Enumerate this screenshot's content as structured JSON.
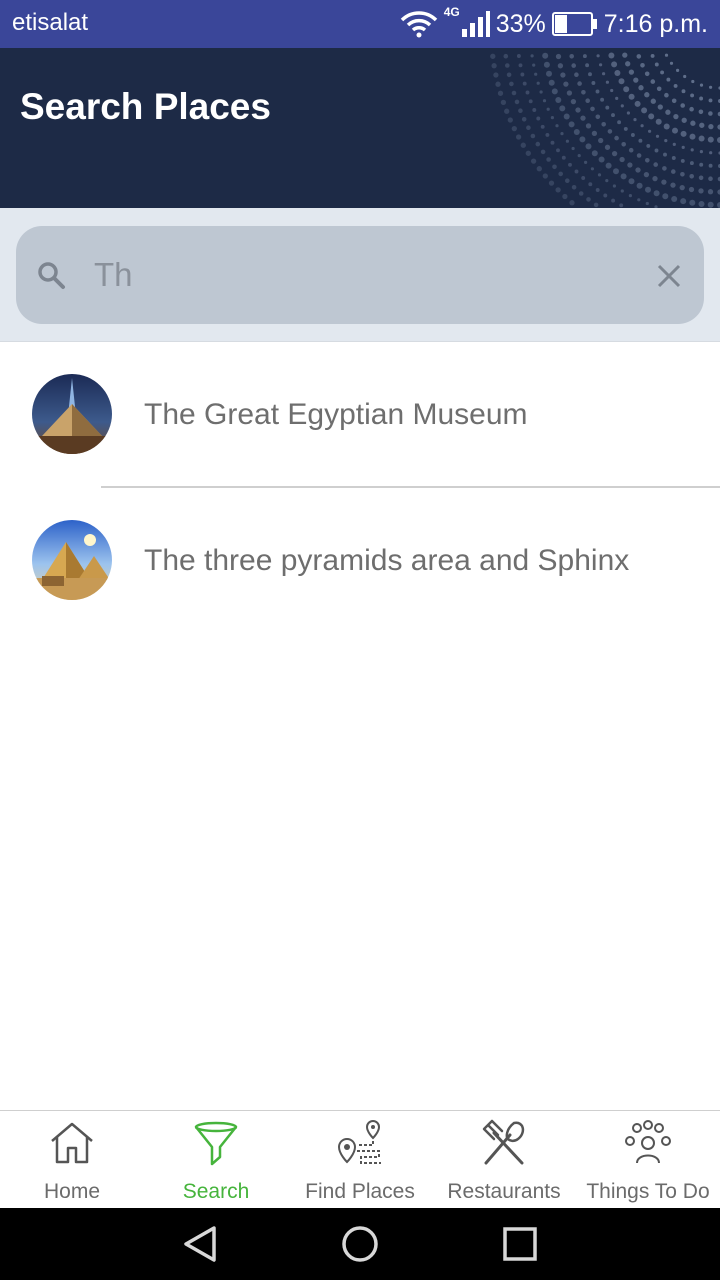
{
  "status_bar": {
    "carrier": "etisalat",
    "network": "4G",
    "battery": "33%",
    "battery_level": 0.33,
    "time": "7:16 p.m."
  },
  "header": {
    "title": "Search Places"
  },
  "search": {
    "value": "Th",
    "icon": "search-icon",
    "clear_icon": "close-icon"
  },
  "results": [
    {
      "label": "The Great Egyptian Museum"
    },
    {
      "label": "The three pyramids area and Sphinx"
    }
  ],
  "bottom_nav": {
    "items": [
      {
        "label": "Home",
        "icon": "home-icon"
      },
      {
        "label": "Search",
        "icon": "filter-icon"
      },
      {
        "label": "Find Places",
        "icon": "route-pin-icon"
      },
      {
        "label": "Restaurants",
        "icon": "fork-spoon-icon"
      },
      {
        "label": "Things To Do",
        "icon": "person-ideas-icon"
      }
    ],
    "active_index": 1
  },
  "colors": {
    "status_bar": "#3a4699",
    "header": "#1d2a46",
    "search_area": "#e2e8ef",
    "search_box": "#bec7d2",
    "active_nav": "#46b43c",
    "nav_text": "#6b6b6b"
  }
}
